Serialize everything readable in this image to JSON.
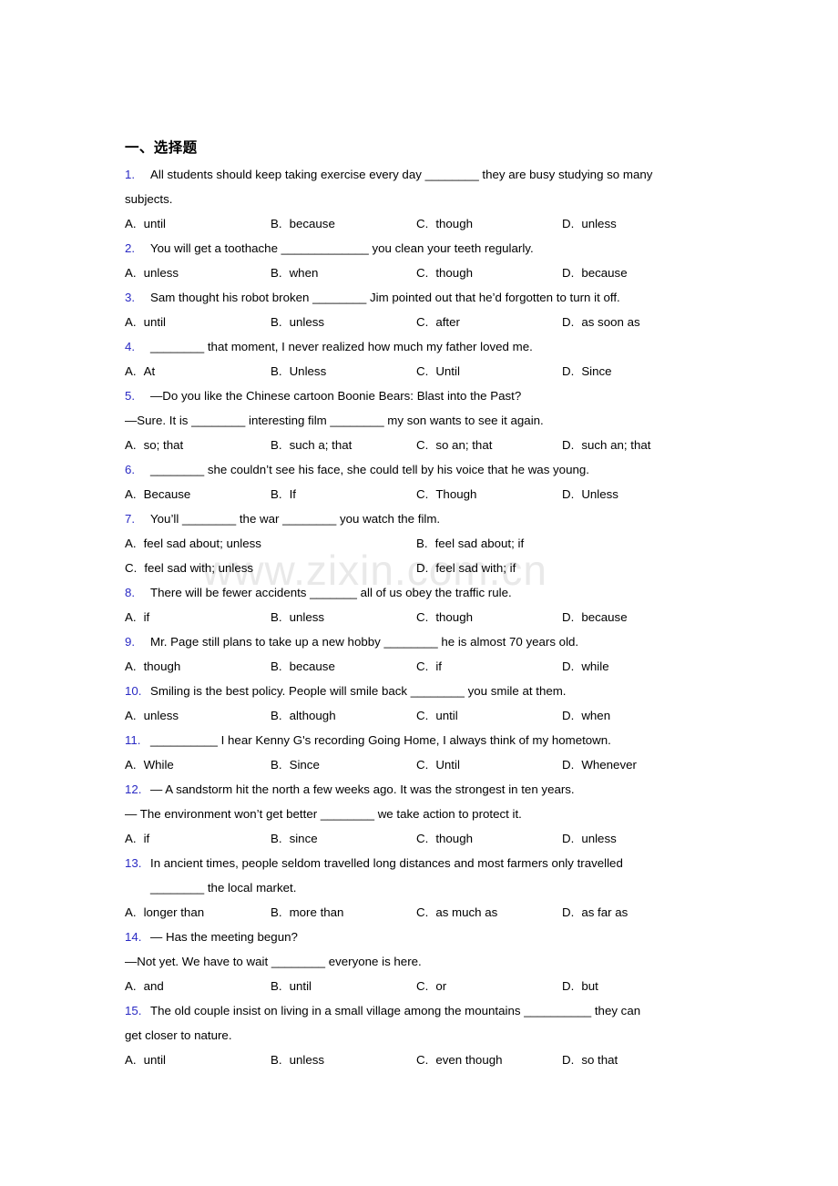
{
  "document": {
    "section_title": "一、选择题",
    "watermark": "www.zixin.com.cn",
    "watermark_color": "#e9e9e9",
    "number_color": "#2a2ac4",
    "text_color": "#000000"
  },
  "questions": [
    {
      "num": "1.",
      "stem": "All students should keep taking exercise every day ________ they are busy studying so many",
      "cont": "subjects.",
      "opt_layout": "four-col",
      "options": [
        {
          "letter": "A.",
          "text": "until"
        },
        {
          "letter": "B.",
          "text": "because"
        },
        {
          "letter": "C.",
          "text": "though"
        },
        {
          "letter": "D.",
          "text": "unless"
        }
      ]
    },
    {
      "num": "2.",
      "stem": "You will get a toothache _____________ you clean your teeth regularly.",
      "opt_layout": "four-col",
      "options": [
        {
          "letter": "A.",
          "text": "unless"
        },
        {
          "letter": "B.",
          "text": "when"
        },
        {
          "letter": "C.",
          "text": "though"
        },
        {
          "letter": "D.",
          "text": "because"
        }
      ]
    },
    {
      "num": "3.",
      "stem": "Sam thought his robot broken ________ Jim pointed out that he’d forgotten to turn it off.",
      "opt_layout": "four-col",
      "options": [
        {
          "letter": "A.",
          "text": "until"
        },
        {
          "letter": "B.",
          "text": "unless"
        },
        {
          "letter": "C.",
          "text": "after"
        },
        {
          "letter": "D.",
          "text": "as soon as"
        }
      ]
    },
    {
      "num": "4.",
      "stem": "________ that moment, I never realized how much my father loved me.",
      "opt_layout": "four-col",
      "options": [
        {
          "letter": "A.",
          "text": "At"
        },
        {
          "letter": "B.",
          "text": "Unless"
        },
        {
          "letter": "C.",
          "text": "Until"
        },
        {
          "letter": "D.",
          "text": "Since"
        }
      ]
    },
    {
      "num": "5.",
      "stem": "—Do you like the Chinese cartoon Boonie Bears: Blast into the Past?",
      "cont": "—Sure. It is ________ interesting film ________ my son wants to see it again.",
      "cont_indent": false,
      "opt_layout": "four-col",
      "options": [
        {
          "letter": "A.",
          "text": "so; that"
        },
        {
          "letter": "B.",
          "text": "such a; that"
        },
        {
          "letter": "C.",
          "text": "so an; that"
        },
        {
          "letter": "D.",
          "text": "such an; that"
        }
      ]
    },
    {
      "num": "6.",
      "stem": "________ she couldn’t see his face, she could tell by his voice that he was young.",
      "opt_layout": "four-col",
      "options": [
        {
          "letter": "A.",
          "text": "Because"
        },
        {
          "letter": "B.",
          "text": "If"
        },
        {
          "letter": "C.",
          "text": "Though"
        },
        {
          "letter": "D.",
          "text": "Unless"
        }
      ]
    },
    {
      "num": "7.",
      "stem": "You’ll ________ the war ________ you watch the film.",
      "opt_layout": "two-col",
      "options": [
        {
          "letter": "A.",
          "text": "feel sad about; unless"
        },
        {
          "letter": "B.",
          "text": "feel sad about; if"
        },
        {
          "letter": "C.",
          "text": "feel sad with; unless"
        },
        {
          "letter": "D.",
          "text": "feel sad with; if"
        }
      ]
    },
    {
      "num": "8.",
      "stem": "There will be fewer accidents _______ all of us obey the traffic rule.",
      "opt_layout": "four-col",
      "options": [
        {
          "letter": "A.",
          "text": "if"
        },
        {
          "letter": "B.",
          "text": "unless"
        },
        {
          "letter": "C.",
          "text": "though"
        },
        {
          "letter": "D.",
          "text": "because"
        }
      ]
    },
    {
      "num": "9.",
      "stem": "Mr. Page still plans to take up a new hobby ________ he is almost 70 years old.",
      "opt_layout": "four-col",
      "options": [
        {
          "letter": "A.",
          "text": "though"
        },
        {
          "letter": "B.",
          "text": "because"
        },
        {
          "letter": "C.",
          "text": "if"
        },
        {
          "letter": "D.",
          "text": "while"
        }
      ]
    },
    {
      "num": "10.",
      "stem": "Smiling is the best policy. People will smile back ________ you smile at them.",
      "opt_layout": "four-col",
      "options": [
        {
          "letter": "A.",
          "text": "unless"
        },
        {
          "letter": "B.",
          "text": "although"
        },
        {
          "letter": "C.",
          "text": "until"
        },
        {
          "letter": "D.",
          "text": "when"
        }
      ]
    },
    {
      "num": "11.",
      "stem": "__________ I hear Kenny G's recording Going Home, I always think of my hometown.",
      "opt_layout": "four-col",
      "options": [
        {
          "letter": "A.",
          "text": "While"
        },
        {
          "letter": "B.",
          "text": "Since"
        },
        {
          "letter": "C.",
          "text": "Until"
        },
        {
          "letter": "D.",
          "text": "Whenever"
        }
      ]
    },
    {
      "num": "12.",
      "stem": "— A sandstorm hit the north a few weeks ago. It was the strongest in ten years.",
      "cont": "— The environment won’t get better ________ we take action to protect it.",
      "cont_indent": false,
      "opt_layout": "four-col",
      "options": [
        {
          "letter": "A.",
          "text": "if"
        },
        {
          "letter": "B.",
          "text": "since"
        },
        {
          "letter": "C.",
          "text": "though"
        },
        {
          "letter": "D.",
          "text": "unless"
        }
      ]
    },
    {
      "num": "13.",
      "stem": "In ancient times, people seldom travelled long distances and most farmers only travelled",
      "cont": "________ the local market.",
      "cont_indent": true,
      "opt_layout": "four-col",
      "options": [
        {
          "letter": "A.",
          "text": "longer than"
        },
        {
          "letter": "B.",
          "text": "more than"
        },
        {
          "letter": "C.",
          "text": "as much as"
        },
        {
          "letter": "D.",
          "text": "as far as"
        }
      ]
    },
    {
      "num": "14.",
      "stem": "— Has the meeting begun?",
      "cont": "—Not yet. We have to wait ________ everyone is here.",
      "cont_indent": false,
      "opt_layout": "four-col",
      "options": [
        {
          "letter": "A.",
          "text": "and"
        },
        {
          "letter": "B.",
          "text": "until"
        },
        {
          "letter": "C.",
          "text": "or"
        },
        {
          "letter": "D.",
          "text": "but"
        }
      ]
    },
    {
      "num": "15.",
      "stem": "The old couple insist on living in a small village among the mountains __________ they can",
      "cont": "get closer to nature.",
      "cont_indent": false,
      "opt_layout": "four-col",
      "options": [
        {
          "letter": "A.",
          "text": "until"
        },
        {
          "letter": "B.",
          "text": "unless"
        },
        {
          "letter": "C.",
          "text": "even though"
        },
        {
          "letter": "D.",
          "text": "so that"
        }
      ]
    }
  ]
}
